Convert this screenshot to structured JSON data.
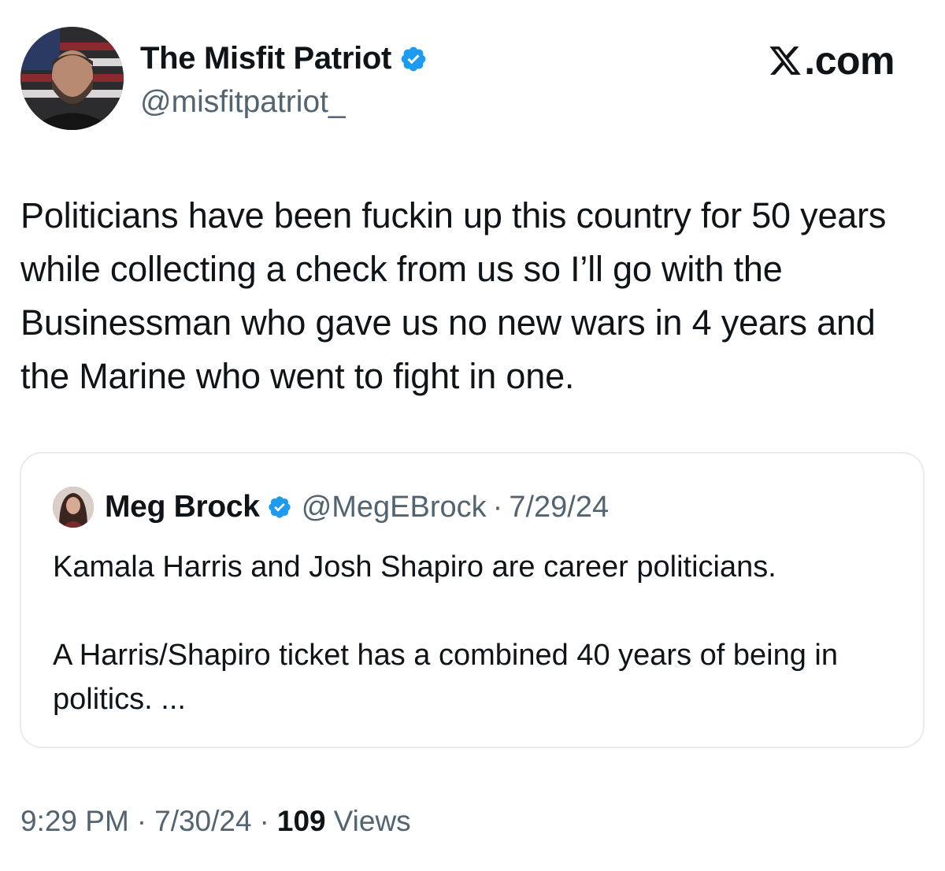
{
  "author": {
    "name": "The Misfit Patriot",
    "handle": "@misfitpatriot_",
    "verified": true,
    "avatar_icon": "man-with-flag-avatar"
  },
  "site": {
    "logo_text": ".com",
    "logo_icon": "x-logo-icon"
  },
  "tweet": {
    "text": "Politicians have been fuckin up this country for 50 years while collecting a check from us so I’ll go with the Businessman who gave us no new wars in 4 years and the Marine who went to fight in one."
  },
  "quote": {
    "name": "Meg Brock",
    "handle": "@MegEBrock",
    "separator": "·",
    "date": "7/29/24",
    "verified": true,
    "avatar_icon": "woman-avatar",
    "paragraphs": [
      "Kamala Harris and Josh Shapiro are career politicians.",
      "A Harris/Shapiro ticket has a combined 40 years of being in politics. ..."
    ]
  },
  "footer": {
    "time": "9:29 PM",
    "separator": "·",
    "date": "7/30/24",
    "views_count": "109",
    "views_label": "Views"
  },
  "colors": {
    "text": "#0f1419",
    "secondary": "#536471",
    "verified_blue": "#1d9bf0",
    "border": "#e6ecf0"
  }
}
